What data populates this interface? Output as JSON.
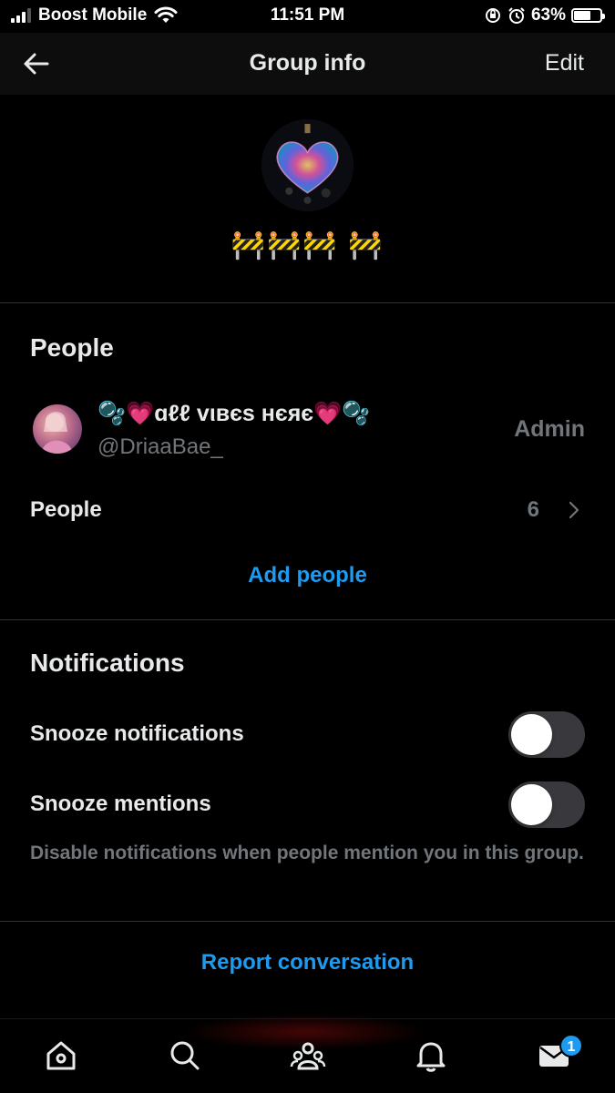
{
  "status_bar": {
    "carrier": "Boost Mobile",
    "time": "11:51 PM",
    "battery": "63%",
    "battery_level": 0.63
  },
  "nav": {
    "title": "Group info",
    "edit_label": "Edit"
  },
  "group": {
    "name": "🚧🚧🚧 🚧"
  },
  "people_section": {
    "title": "People",
    "member": {
      "display_name": "🫧💗ɑℓℓ vιвєѕ нєяє💗🫧",
      "handle": "@DriaaBae_",
      "role": "Admin"
    },
    "people_label": "People",
    "people_count": "6",
    "add_people": "Add people"
  },
  "notifications_section": {
    "title": "Notifications",
    "snooze_notifications": "Snooze notifications",
    "snooze_notifications_on": false,
    "snooze_mentions": "Snooze mentions",
    "snooze_mentions_on": false,
    "helper": "Disable notifications when people mention you in this group."
  },
  "report": "Report conversation",
  "tab_bar": {
    "items": [
      "home-icon",
      "search-icon",
      "communities-icon",
      "notifications-bell-icon",
      "messages-icon"
    ],
    "messages_badge": "1"
  },
  "colors": {
    "accent": "#1d9bf0",
    "background": "#000000",
    "secondary_text": "#71767b"
  }
}
